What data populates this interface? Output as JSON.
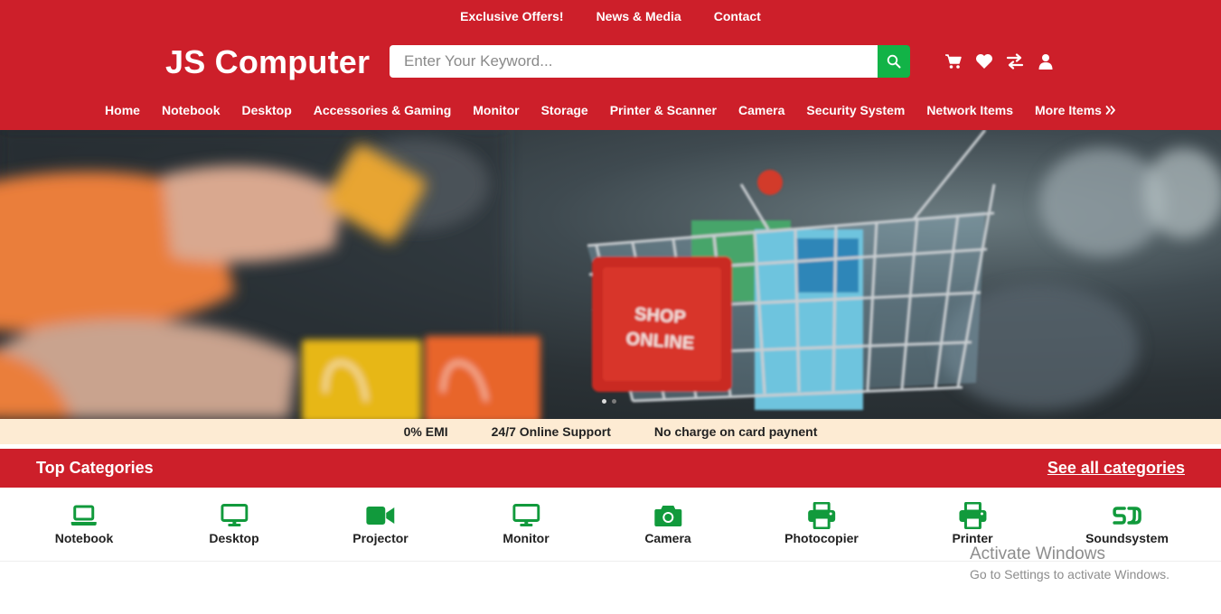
{
  "top_nav": [
    "Exclusive Offers!",
    "News & Media",
    "Contact"
  ],
  "logo": "JS Computer",
  "search": {
    "placeholder": "Enter Your Keyword...",
    "value": ""
  },
  "header_icons": [
    "cart-icon",
    "heart-icon",
    "compare-icon",
    "user-icon"
  ],
  "main_nav": [
    "Home",
    "Notebook",
    "Desktop",
    "Accessories & Gaming",
    "Monitor",
    "Storage",
    "Printer & Scanner",
    "Camera",
    "Security System",
    "Network Items",
    "More Items"
  ],
  "hero": {
    "sign_text_line1": "SHOP",
    "sign_text_line2": "ONLINE"
  },
  "perks": [
    "0% EMI",
    "24/7 Online Support",
    "No charge on card paynent"
  ],
  "categories_section": {
    "title": "Top Categories",
    "link": "See all categories",
    "items": [
      {
        "label": "Notebook",
        "icon": "laptop-icon"
      },
      {
        "label": "Desktop",
        "icon": "desktop-icon"
      },
      {
        "label": "Projector",
        "icon": "video-camera-icon"
      },
      {
        "label": "Monitor",
        "icon": "monitor-icon"
      },
      {
        "label": "Camera",
        "icon": "camera-icon"
      },
      {
        "label": "Photocopier",
        "icon": "printer-icon"
      },
      {
        "label": "Printer",
        "icon": "printer-icon"
      },
      {
        "label": "Soundsystem",
        "icon": "soundsystem-icon"
      }
    ]
  },
  "watermark": {
    "line1": "Activate Windows",
    "line2": "Go to Settings to activate Windows."
  },
  "colors": {
    "brand_red": "#cd1f2a",
    "accent_green": "#12b347",
    "perk_bg": "#fdebd3",
    "icon_green": "#119a3c"
  }
}
